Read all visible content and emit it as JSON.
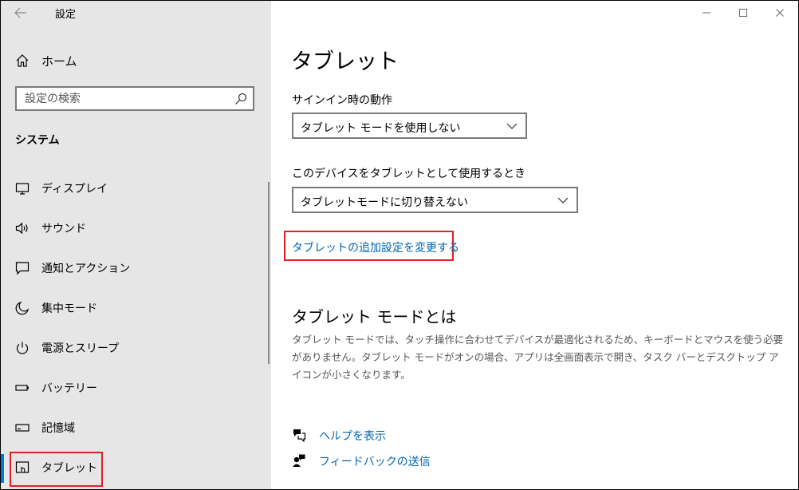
{
  "app": {
    "title": "設定"
  },
  "sidebar": {
    "home_label": "ホーム",
    "search_placeholder": "設定の検索",
    "section_title": "システム",
    "items": [
      {
        "label": "ディスプレイ",
        "icon": "monitor-icon"
      },
      {
        "label": "サウンド",
        "icon": "speaker-icon"
      },
      {
        "label": "通知とアクション",
        "icon": "notification-icon"
      },
      {
        "label": "集中モード",
        "icon": "moon-icon"
      },
      {
        "label": "電源とスリープ",
        "icon": "power-icon"
      },
      {
        "label": "バッテリー",
        "icon": "battery-icon"
      },
      {
        "label": "記憶域",
        "icon": "storage-icon"
      },
      {
        "label": "タブレット",
        "icon": "tablet-icon",
        "selected": true
      }
    ]
  },
  "main": {
    "title": "タブレット",
    "signin": {
      "label": "サインイン時の動作",
      "value": "タブレット モードを使用しない"
    },
    "tablet_use": {
      "label": "このデバイスをタブレットとして使用するとき",
      "value": "タブレットモードに切り替えない"
    },
    "advanced_link": "タブレットの追加設定を変更する",
    "about": {
      "title": "タブレット モードとは",
      "description": "タブレット モードでは、タッチ操作に合わせてデバイスが最適化されるため、キーボードとマウスを使う必要がありません。タブレット モードがオンの場合、アプリは全画面表示で開き、タスク バーとデスクトップ アイコンが小さくなります。"
    },
    "help_label": "ヘルプを表示",
    "feedback_label": "フィードバックの送信"
  },
  "colors": {
    "accent": "#0078d7",
    "link": "#0066b4",
    "highlight_red": "#e31f26",
    "sidebar_bg": "#e6e6e6"
  }
}
